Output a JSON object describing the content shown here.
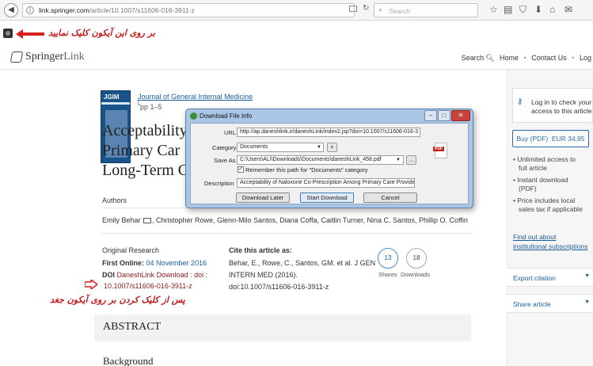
{
  "browser": {
    "url_domain": "link.springer.com",
    "url_path": "/article/10.1007/s11606-016-3911-z",
    "search_placeholder": "Search"
  },
  "annotations": {
    "top": "بر روی این آیکون کلیک نمایید",
    "bottom": "پس از کلیک کردن بر روی آیکون جغد"
  },
  "header": {
    "logo_bold": "Springer",
    "logo_thin": "Link",
    "nav": {
      "search": "Search",
      "home": "Home",
      "contact": "Contact Us",
      "log": "Log"
    }
  },
  "article": {
    "cover_title": "JGIM",
    "journal": "Journal of General Internal Medicine",
    "pages": "pp 1–5",
    "title_lines": [
      "Acceptability",
      "Primary Car",
      "Long-Term C"
    ],
    "authors_label": "Authors",
    "authors_before_mail": "Emily Behar",
    "authors_after_mail": ", Christopher Rowe, Glenn-Milo Santos, Diana Coffa, Caitlin Turner, Nina C. Santos, Phillip O. Coffin",
    "category": "Original Research",
    "first_online_label": "First Online:",
    "first_online_date": "04 November 2016",
    "doi_label": "DOI",
    "doi_link_prefix": "DaneshLink Download : doi :",
    "doi_value": "10.1007/s11606-016-3911-z",
    "cite_title": "Cite this article as:",
    "cite_lines": [
      "Behar, E., Rowe, C., Santos, GM. et al. J GEN",
      "INTERN MED (2016).",
      "doi:10.1007/s11606-016-3911-z"
    ],
    "shares_count": "13",
    "downloads_count": "18",
    "shares_label": "Shares",
    "downloads_label": "Downloads",
    "abstract": "ABSTRACT",
    "background": "Background"
  },
  "sidebar": {
    "login_lines": [
      "Log in to check your",
      "access to this article"
    ],
    "buy_label": "Buy (PDF)",
    "buy_price": "EUR 34,95",
    "bullets": [
      "Unlimited access to",
      "full article",
      "Instant download",
      "(PDF)",
      "Price includes local",
      "sales tax if applicable"
    ],
    "find_out_lines": [
      "Find out about",
      "institutional subscriptions"
    ],
    "export": "Export citation",
    "share": "Share article"
  },
  "dialog": {
    "title": "Download File Info",
    "url_label": "URL",
    "url_value": "http://ap.daneshlink.ir/daneshLink/index2.jsp?doi=10.1007/s11606-016-3",
    "category_label": "Category",
    "category_value": "Documents",
    "saveas_label": "Save As",
    "saveas_value": "C:\\Users\\ALI\\Downloads\\Documents\\daneshLink_458.pdf",
    "remember_label": "Remember this path for \"Documents\" category",
    "description_label": "Description",
    "description_value": "Acceptability of Naloxone Co-Prescription Among Primary Care Providers Tr",
    "btn_later": "Download Later",
    "btn_start": "Start Download",
    "btn_cancel": "Cancel",
    "pdf_badge": "PDF"
  }
}
